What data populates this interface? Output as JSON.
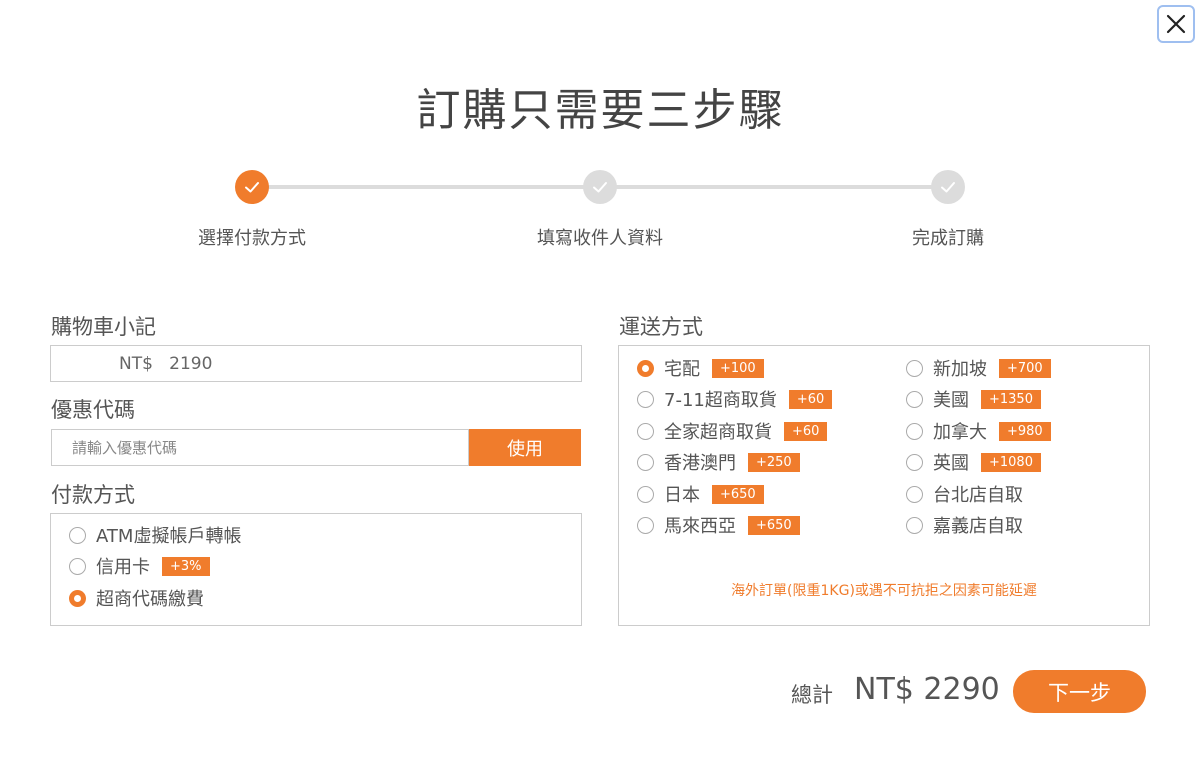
{
  "title": "訂購只需要三步驟",
  "steps": [
    {
      "label": "選擇付款方式",
      "state": "active"
    },
    {
      "label": "填寫收件人資料",
      "state": "inactive"
    },
    {
      "label": "完成訂購",
      "state": "inactive"
    }
  ],
  "cart": {
    "label": "購物車小記",
    "value": "NT$   2190"
  },
  "coupon": {
    "label": "優惠代碼",
    "placeholder": "請輸入優惠代碼",
    "apply_label": "使用"
  },
  "payment": {
    "label": "付款方式",
    "options": [
      {
        "label": "ATM虛擬帳戶轉帳",
        "badge": "",
        "checked": false
      },
      {
        "label": "信用卡",
        "badge": "+3%",
        "checked": false
      },
      {
        "label": "超商代碼繳費",
        "badge": "",
        "checked": true
      }
    ]
  },
  "shipping": {
    "label": "運送方式",
    "left_options": [
      {
        "label": "宅配",
        "badge": "+100",
        "checked": true
      },
      {
        "label": "7-11超商取貨",
        "badge": "+60",
        "checked": false
      },
      {
        "label": "全家超商取貨",
        "badge": "+60",
        "checked": false
      },
      {
        "label": "香港澳門",
        "badge": "+250",
        "checked": false
      },
      {
        "label": "日本",
        "badge": "+650",
        "checked": false
      },
      {
        "label": "馬來西亞",
        "badge": "+650",
        "checked": false
      }
    ],
    "right_options": [
      {
        "label": "新加坡",
        "badge": "+700",
        "checked": false
      },
      {
        "label": "美國",
        "badge": "+1350",
        "checked": false
      },
      {
        "label": "加拿大",
        "badge": "+980",
        "checked": false
      },
      {
        "label": "英國",
        "badge": "+1080",
        "checked": false
      },
      {
        "label": "台北店自取",
        "badge": "",
        "checked": false
      },
      {
        "label": "嘉義店自取",
        "badge": "",
        "checked": false
      }
    ],
    "note": "海外訂單(限重1KG)或遇不可抗拒之因素可能延遲"
  },
  "total": {
    "label": "總計",
    "value": "NT$ 2290"
  },
  "next_label": "下一步",
  "colors": {
    "accent": "#f07c2c",
    "inactive_step": "#dcdcdc",
    "border": "#cccccc"
  }
}
